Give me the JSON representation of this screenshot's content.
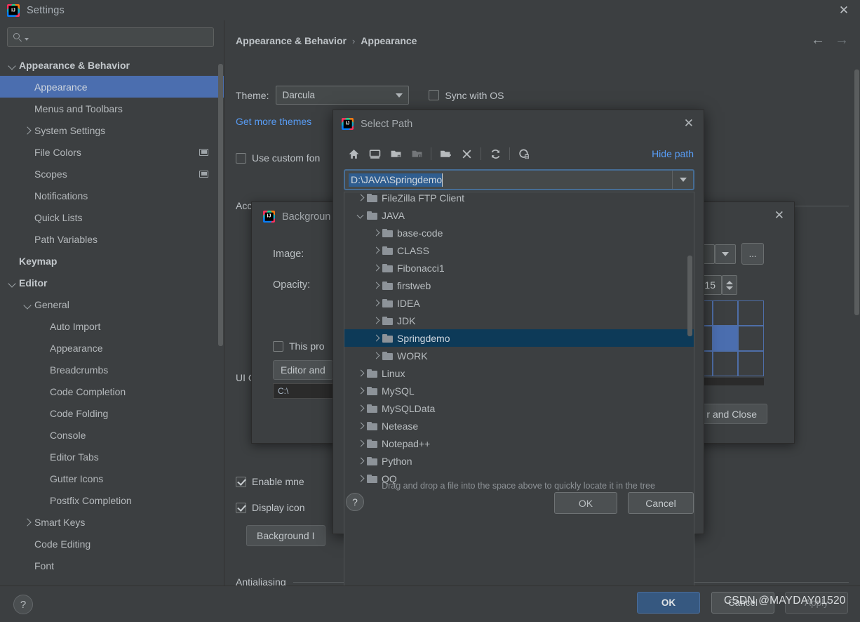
{
  "window": {
    "title": "Settings",
    "close_label": "✕",
    "app_icon": "intellij-idea-icon"
  },
  "sidebar": {
    "search": {
      "value": "",
      "placeholder": ""
    },
    "items": [
      {
        "label": "Appearance & Behavior",
        "indent": 0,
        "twisty": "down",
        "bold": true,
        "selected": false,
        "badge": false
      },
      {
        "label": "Appearance",
        "indent": 1,
        "twisty": "none",
        "bold": false,
        "selected": true,
        "badge": false
      },
      {
        "label": "Menus and Toolbars",
        "indent": 1,
        "twisty": "none",
        "bold": false,
        "selected": false,
        "badge": false
      },
      {
        "label": "System Settings",
        "indent": 1,
        "twisty": "right",
        "bold": false,
        "selected": false,
        "badge": false
      },
      {
        "label": "File Colors",
        "indent": 1,
        "twisty": "none",
        "bold": false,
        "selected": false,
        "badge": true
      },
      {
        "label": "Scopes",
        "indent": 1,
        "twisty": "none",
        "bold": false,
        "selected": false,
        "badge": true
      },
      {
        "label": "Notifications",
        "indent": 1,
        "twisty": "none",
        "bold": false,
        "selected": false,
        "badge": false
      },
      {
        "label": "Quick Lists",
        "indent": 1,
        "twisty": "none",
        "bold": false,
        "selected": false,
        "badge": false
      },
      {
        "label": "Path Variables",
        "indent": 1,
        "twisty": "none",
        "bold": false,
        "selected": false,
        "badge": false
      },
      {
        "label": "Keymap",
        "indent": 0,
        "twisty": "none",
        "bold": true,
        "selected": false,
        "badge": false
      },
      {
        "label": "Editor",
        "indent": 0,
        "twisty": "down",
        "bold": true,
        "selected": false,
        "badge": false
      },
      {
        "label": "General",
        "indent": 1,
        "twisty": "down",
        "bold": false,
        "selected": false,
        "badge": false
      },
      {
        "label": "Auto Import",
        "indent": 2,
        "twisty": "none",
        "bold": false,
        "selected": false,
        "badge": false
      },
      {
        "label": "Appearance",
        "indent": 2,
        "twisty": "none",
        "bold": false,
        "selected": false,
        "badge": false
      },
      {
        "label": "Breadcrumbs",
        "indent": 2,
        "twisty": "none",
        "bold": false,
        "selected": false,
        "badge": false
      },
      {
        "label": "Code Completion",
        "indent": 2,
        "twisty": "none",
        "bold": false,
        "selected": false,
        "badge": false
      },
      {
        "label": "Code Folding",
        "indent": 2,
        "twisty": "none",
        "bold": false,
        "selected": false,
        "badge": false
      },
      {
        "label": "Console",
        "indent": 2,
        "twisty": "none",
        "bold": false,
        "selected": false,
        "badge": false
      },
      {
        "label": "Editor Tabs",
        "indent": 2,
        "twisty": "none",
        "bold": false,
        "selected": false,
        "badge": false
      },
      {
        "label": "Gutter Icons",
        "indent": 2,
        "twisty": "none",
        "bold": false,
        "selected": false,
        "badge": false
      },
      {
        "label": "Postfix Completion",
        "indent": 2,
        "twisty": "none",
        "bold": false,
        "selected": false,
        "badge": false
      },
      {
        "label": "Smart Keys",
        "indent": 1,
        "twisty": "right",
        "bold": false,
        "selected": false,
        "badge": false
      },
      {
        "label": "Code Editing",
        "indent": 1,
        "twisty": "none",
        "bold": false,
        "selected": false,
        "badge": false
      },
      {
        "label": "Font",
        "indent": 1,
        "twisty": "none",
        "bold": false,
        "selected": false,
        "badge": false
      }
    ]
  },
  "main": {
    "breadcrumb_root": "Appearance & Behavior",
    "breadcrumb_sep": "›",
    "breadcrumb_leaf": "Appearance",
    "back_arrow": "←",
    "forward_arrow": "→",
    "theme_label": "Theme:",
    "theme_value": "Darcula",
    "sync_with_os": "Sync with OS",
    "get_more_themes": "Get more themes",
    "use_custom_font": "Use custom fon",
    "accessibility_section": "Accessibility",
    "ui_options_label": "UI O",
    "enable_mnemonics": "Enable mne",
    "display_icons": "Display icon",
    "background_image_button": "Background I",
    "antialiasing_section": "Antialiasing"
  },
  "background_dialog": {
    "title": "Backgroun",
    "close_label": "✕",
    "image_label": "Image:",
    "opacity_label": "Opacity:",
    "opacity_value": "15",
    "browse_label": "...",
    "this_project_label": "This pro",
    "editor_button": "Editor and ",
    "path_value": "C:\\",
    "and_close_button": "r and Close"
  },
  "select_path_dialog": {
    "title": "Select Path",
    "close_label": "✕",
    "hide_path_link": "Hide path",
    "path_value": "D:\\JAVA\\Springdemo",
    "toolbar": [
      {
        "name": "home-icon",
        "enabled": true
      },
      {
        "name": "desktop-icon",
        "enabled": true
      },
      {
        "name": "collapse-folder-icon",
        "enabled": true
      },
      {
        "name": "expand-folder-icon",
        "enabled": false
      },
      {
        "name": "new-folder-icon",
        "enabled": true
      },
      {
        "name": "delete-icon",
        "enabled": true
      },
      {
        "name": "refresh-icon",
        "enabled": true
      },
      {
        "name": "show-hidden-files-icon",
        "enabled": true
      }
    ],
    "tree": [
      {
        "label": "FileZilla FTP Client",
        "indent": 0,
        "twisty": "right",
        "selected": false
      },
      {
        "label": "JAVA",
        "indent": 0,
        "twisty": "down",
        "selected": false
      },
      {
        "label": "base-code",
        "indent": 1,
        "twisty": "right",
        "selected": false
      },
      {
        "label": "CLASS",
        "indent": 1,
        "twisty": "right",
        "selected": false
      },
      {
        "label": "Fibonacci1",
        "indent": 1,
        "twisty": "right",
        "selected": false
      },
      {
        "label": "firstweb",
        "indent": 1,
        "twisty": "right",
        "selected": false
      },
      {
        "label": "IDEA",
        "indent": 1,
        "twisty": "right",
        "selected": false
      },
      {
        "label": "JDK",
        "indent": 1,
        "twisty": "right",
        "selected": false
      },
      {
        "label": "Springdemo",
        "indent": 1,
        "twisty": "right",
        "selected": true
      },
      {
        "label": "WORK",
        "indent": 1,
        "twisty": "right",
        "selected": false
      },
      {
        "label": "Linux",
        "indent": 0,
        "twisty": "right",
        "selected": false
      },
      {
        "label": "MySQL",
        "indent": 0,
        "twisty": "right",
        "selected": false
      },
      {
        "label": "MySQLData",
        "indent": 0,
        "twisty": "right",
        "selected": false
      },
      {
        "label": "Netease",
        "indent": 0,
        "twisty": "right",
        "selected": false
      },
      {
        "label": "Notepad++",
        "indent": 0,
        "twisty": "right",
        "selected": false
      },
      {
        "label": "Python",
        "indent": 0,
        "twisty": "right",
        "selected": false
      },
      {
        "label": "QQ",
        "indent": 0,
        "twisty": "right",
        "selected": false
      }
    ],
    "hint": "Drag and drop a file into the space above to quickly locate it in the tree",
    "help_label": "?",
    "ok_label": "OK",
    "cancel_label": "Cancel"
  },
  "bottom_bar": {
    "help_label": "?",
    "ok_label": "OK",
    "cancel_label": "Cancel",
    "apply_label": "Apply"
  },
  "watermark": "CSDN @MAYDAY01520",
  "colors": {
    "background": "#3c3f41",
    "sidebar_selection": "#4b6eaf",
    "tree_selection": "#0d3a58",
    "accent_link": "#589df6",
    "primary_button": "#365880",
    "text_selection": "#2f5d8f"
  }
}
